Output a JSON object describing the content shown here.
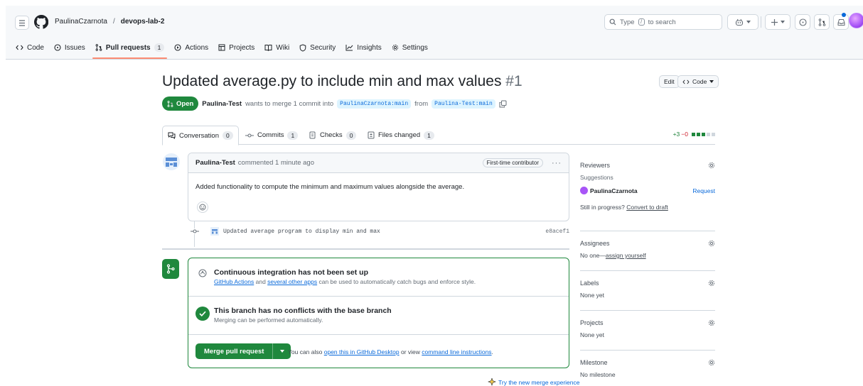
{
  "header": {
    "owner": "PaulinaCzarnota",
    "separator": "/",
    "repo": "devops-lab-2",
    "search_prefix": "Type",
    "search_key": "/",
    "search_suffix": "to search"
  },
  "repo_tabs": [
    {
      "label": "Code"
    },
    {
      "label": "Issues"
    },
    {
      "label": "Pull requests",
      "count": "1"
    },
    {
      "label": "Actions"
    },
    {
      "label": "Projects"
    },
    {
      "label": "Wiki"
    },
    {
      "label": "Security"
    },
    {
      "label": "Insights"
    },
    {
      "label": "Settings"
    }
  ],
  "pr": {
    "title": "Updated average.py to include min and max values",
    "number": "#1",
    "edit_label": "Edit",
    "code_label": "Code",
    "state": "Open",
    "author": "Paulina-Test",
    "meta_text": "wants to merge 1 commit into",
    "base_branch": "PaulinaCzarnota:main",
    "from_text": "from",
    "head_branch": "Paulina-Test:main"
  },
  "pr_tabs": [
    {
      "label": "Conversation",
      "count": "0"
    },
    {
      "label": "Commits",
      "count": "1"
    },
    {
      "label": "Checks",
      "count": "0"
    },
    {
      "label": "Files changed",
      "count": "1"
    }
  ],
  "diffstat": {
    "added": "+3",
    "removed": "−0"
  },
  "comment": {
    "author": "Paulina-Test",
    "action": "commented 1 minute ago",
    "badge": "First-time contributor",
    "body": "Added functionality to compute the minimum and maximum values alongside the average."
  },
  "commit": {
    "message": "Updated average program to display min and max",
    "sha": "e8acef1"
  },
  "merge": {
    "ci_title": "Continuous integration has not been set up",
    "ci_link1": "GitHub Actions",
    "ci_and": "and",
    "ci_link2": "several other apps",
    "ci_rest": "can be used to automatically catch bugs and enforce style.",
    "conflict_title": "This branch has no conflicts with the base branch",
    "conflict_sub": "Merging can be performed automatically.",
    "button": "Merge pull request",
    "also_prefix": "You can also",
    "also_link1": "open this in GitHub Desktop",
    "also_mid": "or view",
    "also_link2": "command line instructions",
    "also_end": ".",
    "try_new": "Try the new merge experience"
  },
  "sidebar": {
    "reviewers_label": "Reviewers",
    "suggestions_label": "Suggestions",
    "suggested_user": "PaulinaCzarnota",
    "request_label": "Request",
    "progress_text": "Still in progress?",
    "convert_link": "Convert to draft",
    "assignees_label": "Assignees",
    "assignees_text": "No one—",
    "assign_link": "assign yourself",
    "labels_label": "Labels",
    "labels_text": "None yet",
    "projects_label": "Projects",
    "projects_text": "None yet",
    "milestone_label": "Milestone",
    "milestone_text": "No milestone"
  },
  "colors": {
    "green": "#1f883d",
    "link": "#0969da",
    "accent_underline": "#fd8c73"
  }
}
